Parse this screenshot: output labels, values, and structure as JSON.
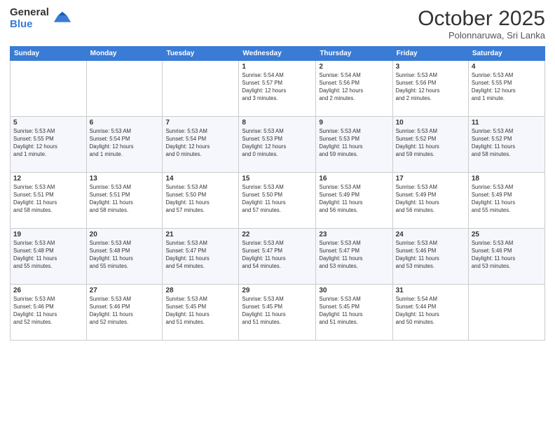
{
  "logo": {
    "general": "General",
    "blue": "Blue"
  },
  "header": {
    "month": "October 2025",
    "location": "Polonnaruwa, Sri Lanka"
  },
  "days_of_week": [
    "Sunday",
    "Monday",
    "Tuesday",
    "Wednesday",
    "Thursday",
    "Friday",
    "Saturday"
  ],
  "weeks": [
    [
      {
        "day": "",
        "info": ""
      },
      {
        "day": "",
        "info": ""
      },
      {
        "day": "",
        "info": ""
      },
      {
        "day": "1",
        "info": "Sunrise: 5:54 AM\nSunset: 5:57 PM\nDaylight: 12 hours\nand 3 minutes."
      },
      {
        "day": "2",
        "info": "Sunrise: 5:54 AM\nSunset: 5:56 PM\nDaylight: 12 hours\nand 2 minutes."
      },
      {
        "day": "3",
        "info": "Sunrise: 5:53 AM\nSunset: 5:56 PM\nDaylight: 12 hours\nand 2 minutes."
      },
      {
        "day": "4",
        "info": "Sunrise: 5:53 AM\nSunset: 5:55 PM\nDaylight: 12 hours\nand 1 minute."
      }
    ],
    [
      {
        "day": "5",
        "info": "Sunrise: 5:53 AM\nSunset: 5:55 PM\nDaylight: 12 hours\nand 1 minute."
      },
      {
        "day": "6",
        "info": "Sunrise: 5:53 AM\nSunset: 5:54 PM\nDaylight: 12 hours\nand 1 minute."
      },
      {
        "day": "7",
        "info": "Sunrise: 5:53 AM\nSunset: 5:54 PM\nDaylight: 12 hours\nand 0 minutes."
      },
      {
        "day": "8",
        "info": "Sunrise: 5:53 AM\nSunset: 5:53 PM\nDaylight: 12 hours\nand 0 minutes."
      },
      {
        "day": "9",
        "info": "Sunrise: 5:53 AM\nSunset: 5:53 PM\nDaylight: 11 hours\nand 59 minutes."
      },
      {
        "day": "10",
        "info": "Sunrise: 5:53 AM\nSunset: 5:52 PM\nDaylight: 11 hours\nand 59 minutes."
      },
      {
        "day": "11",
        "info": "Sunrise: 5:53 AM\nSunset: 5:52 PM\nDaylight: 11 hours\nand 58 minutes."
      }
    ],
    [
      {
        "day": "12",
        "info": "Sunrise: 5:53 AM\nSunset: 5:51 PM\nDaylight: 11 hours\nand 58 minutes."
      },
      {
        "day": "13",
        "info": "Sunrise: 5:53 AM\nSunset: 5:51 PM\nDaylight: 11 hours\nand 58 minutes."
      },
      {
        "day": "14",
        "info": "Sunrise: 5:53 AM\nSunset: 5:50 PM\nDaylight: 11 hours\nand 57 minutes."
      },
      {
        "day": "15",
        "info": "Sunrise: 5:53 AM\nSunset: 5:50 PM\nDaylight: 11 hours\nand 57 minutes."
      },
      {
        "day": "16",
        "info": "Sunrise: 5:53 AM\nSunset: 5:49 PM\nDaylight: 11 hours\nand 56 minutes."
      },
      {
        "day": "17",
        "info": "Sunrise: 5:53 AM\nSunset: 5:49 PM\nDaylight: 11 hours\nand 56 minutes."
      },
      {
        "day": "18",
        "info": "Sunrise: 5:53 AM\nSunset: 5:49 PM\nDaylight: 11 hours\nand 55 minutes."
      }
    ],
    [
      {
        "day": "19",
        "info": "Sunrise: 5:53 AM\nSunset: 5:48 PM\nDaylight: 11 hours\nand 55 minutes."
      },
      {
        "day": "20",
        "info": "Sunrise: 5:53 AM\nSunset: 5:48 PM\nDaylight: 11 hours\nand 55 minutes."
      },
      {
        "day": "21",
        "info": "Sunrise: 5:53 AM\nSunset: 5:47 PM\nDaylight: 11 hours\nand 54 minutes."
      },
      {
        "day": "22",
        "info": "Sunrise: 5:53 AM\nSunset: 5:47 PM\nDaylight: 11 hours\nand 54 minutes."
      },
      {
        "day": "23",
        "info": "Sunrise: 5:53 AM\nSunset: 5:47 PM\nDaylight: 11 hours\nand 53 minutes."
      },
      {
        "day": "24",
        "info": "Sunrise: 5:53 AM\nSunset: 5:46 PM\nDaylight: 11 hours\nand 53 minutes."
      },
      {
        "day": "25",
        "info": "Sunrise: 5:53 AM\nSunset: 5:46 PM\nDaylight: 11 hours\nand 53 minutes."
      }
    ],
    [
      {
        "day": "26",
        "info": "Sunrise: 5:53 AM\nSunset: 5:46 PM\nDaylight: 11 hours\nand 52 minutes."
      },
      {
        "day": "27",
        "info": "Sunrise: 5:53 AM\nSunset: 5:46 PM\nDaylight: 11 hours\nand 52 minutes."
      },
      {
        "day": "28",
        "info": "Sunrise: 5:53 AM\nSunset: 5:45 PM\nDaylight: 11 hours\nand 51 minutes."
      },
      {
        "day": "29",
        "info": "Sunrise: 5:53 AM\nSunset: 5:45 PM\nDaylight: 11 hours\nand 51 minutes."
      },
      {
        "day": "30",
        "info": "Sunrise: 5:53 AM\nSunset: 5:45 PM\nDaylight: 11 hours\nand 51 minutes."
      },
      {
        "day": "31",
        "info": "Sunrise: 5:54 AM\nSunset: 5:44 PM\nDaylight: 11 hours\nand 50 minutes."
      },
      {
        "day": "",
        "info": ""
      }
    ]
  ]
}
